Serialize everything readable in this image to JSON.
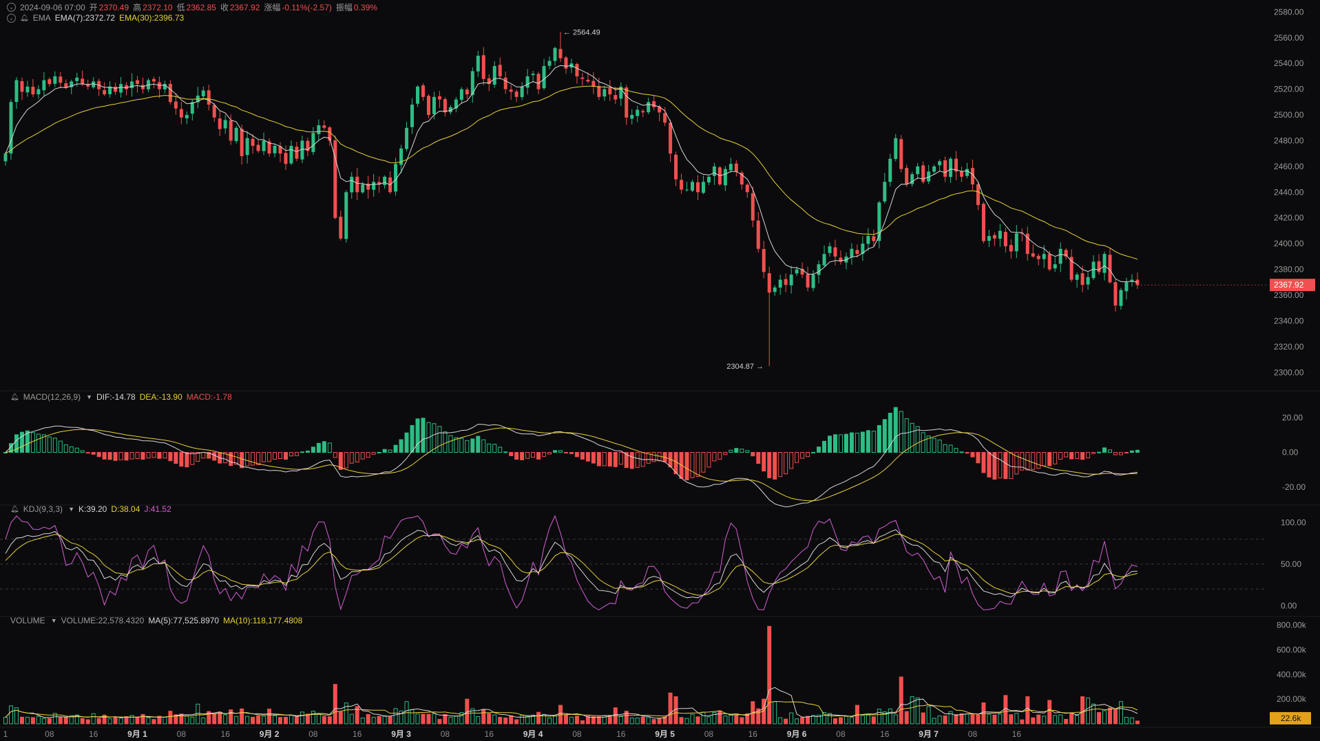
{
  "header": {
    "date": "2024-09-06 07:00",
    "open_label": "开",
    "open": "2370.49",
    "high_label": "高",
    "high": "2372.10",
    "low_label": "低",
    "low": "2362.85",
    "close_label": "收",
    "close": "2367.92",
    "change_label": "涨幅",
    "change": "-0.11%(-2.57)",
    "amplitude_label": "振幅",
    "amplitude": "0.39%"
  },
  "ema": {
    "label": "EMA",
    "ema7": "EMA(7):2372.72",
    "ema30": "EMA(30):2396.73"
  },
  "macd": {
    "label": "MACD(12,26,9)",
    "dif": "DIF:-14.78",
    "dea": "DEA:-13.90",
    "macd": "MACD:-1.78"
  },
  "kdj": {
    "label": "KDJ(9,3,3)",
    "k": "K:39.20",
    "d": "D:38.04",
    "j": "J:41.52"
  },
  "volume": {
    "label": "VOLUME",
    "vol": "VOLUME:22,578.4320",
    "ma5": "MA(5):77,525.8970",
    "ma10": "MA(10):118,177.4808"
  },
  "colors": {
    "up": "#2ebd85",
    "down": "#f0504f",
    "ema7": "#d8d8d8",
    "ema30": "#e9d23b",
    "j": "#d65fd6",
    "bg": "#0b0b0d"
  },
  "chart_data": [
    {
      "type": "candlestick",
      "name": "price",
      "ylim": [
        2290,
        2585
      ],
      "yticks": [
        "2580.00",
        "2560.00",
        "2540.00",
        "2520.00",
        "2500.00",
        "2480.00",
        "2460.00",
        "2440.00",
        "2420.00",
        "2400.00",
        "2380.00",
        "2360.00",
        "2340.00",
        "2320.00",
        "2300.00"
      ],
      "ytick_values": [
        2580,
        2560,
        2540,
        2520,
        2500,
        2480,
        2460,
        2440,
        2420,
        2400,
        2380,
        2360,
        2340,
        2320,
        2300
      ],
      "last_price": "2367.92",
      "last_value": 2367.92,
      "high_marker": "2564.49",
      "high_value": 2564.49,
      "high_index": 101,
      "low_marker": "2304.87",
      "low_value": 2304.87,
      "low_index": 139,
      "close": [
        2470,
        2510,
        2527,
        2518,
        2522,
        2516,
        2520,
        2527,
        2524,
        2530,
        2525,
        2521,
        2526,
        2529,
        2524,
        2522,
        2526,
        2520,
        2516,
        2522,
        2518,
        2524,
        2520,
        2526,
        2524,
        2520,
        2527,
        2526,
        2520,
        2524,
        2510,
        2505,
        2498,
        2500,
        2510,
        2515,
        2519,
        2508,
        2498,
        2489,
        2496,
        2480,
        2490,
        2468,
        2482,
        2476,
        2472,
        2480,
        2470,
        2476,
        2470,
        2462,
        2476,
        2466,
        2480,
        2472,
        2486,
        2492,
        2490,
        2480,
        2420,
        2404,
        2440,
        2452,
        2440,
        2446,
        2442,
        2448,
        2446,
        2452,
        2440,
        2462,
        2474,
        2490,
        2508,
        2522,
        2514,
        2500,
        2514,
        2512,
        2502,
        2506,
        2512,
        2520,
        2516,
        2534,
        2546,
        2528,
        2524,
        2538,
        2530,
        2520,
        2518,
        2514,
        2522,
        2530,
        2532,
        2520,
        2538,
        2542,
        2552,
        2544,
        2536,
        2540,
        2530,
        2528,
        2526,
        2522,
        2514,
        2520,
        2516,
        2512,
        2522,
        2498,
        2500,
        2504,
        2502,
        2510,
        2506,
        2502,
        2494,
        2470,
        2450,
        2442,
        2442,
        2448,
        2440,
        2448,
        2452,
        2460,
        2446,
        2458,
        2462,
        2456,
        2446,
        2440,
        2418,
        2396,
        2378,
        2362,
        2366,
        2372,
        2368,
        2376,
        2380,
        2376,
        2366,
        2376,
        2384,
        2392,
        2398,
        2390,
        2386,
        2390,
        2396,
        2392,
        2400,
        2406,
        2402,
        2432,
        2448,
        2466,
        2482,
        2458,
        2446,
        2454,
        2460,
        2448,
        2456,
        2460,
        2464,
        2452,
        2466,
        2456,
        2452,
        2458,
        2446,
        2430,
        2402,
        2406,
        2404,
        2410,
        2398,
        2394,
        2408,
        2408,
        2392,
        2390,
        2388,
        2392,
        2380,
        2384,
        2396,
        2390,
        2372,
        2376,
        2368,
        2374,
        2386,
        2378,
        2392,
        2370,
        2352,
        2364,
        2370,
        2372,
        2367.92
      ]
    },
    {
      "type": "macd",
      "name": "MACD(12,26,9)",
      "ylim": [
        -28,
        30
      ],
      "yticks": [
        "20.00",
        "0.00",
        "-20.00"
      ],
      "ytick_values": [
        20,
        0,
        -20
      ]
    },
    {
      "type": "kdj",
      "name": "KDJ(9,3,3)",
      "ylim": [
        -8,
        112
      ],
      "yticks": [
        "100.00",
        "50.00",
        "0.00"
      ],
      "ytick_values": [
        100,
        50,
        0
      ],
      "reference_lines": [
        80,
        50,
        20
      ]
    },
    {
      "type": "volume",
      "name": "VOLUME",
      "ylim": [
        0,
        820000
      ],
      "yticks": [
        "800.00k",
        "600.00k",
        "400.00k",
        "200.00k"
      ],
      "ytick_values": [
        800000,
        600000,
        400000,
        200000
      ],
      "last_volume": "22.6k",
      "last_value": 22578.432,
      "spikes": [
        {
          "index": 2,
          "value": 130000
        },
        {
          "index": 35,
          "value": 160000
        },
        {
          "index": 48,
          "value": 120000
        },
        {
          "index": 60,
          "value": 320000
        },
        {
          "index": 64,
          "value": 140000
        },
        {
          "index": 73,
          "value": 180000
        },
        {
          "index": 84,
          "value": 200000
        },
        {
          "index": 101,
          "value": 150000
        },
        {
          "index": 111,
          "value": 130000
        },
        {
          "index": 121,
          "value": 250000
        },
        {
          "index": 122,
          "value": 220000
        },
        {
          "index": 136,
          "value": 180000
        },
        {
          "index": 138,
          "value": 200000
        },
        {
          "index": 139,
          "value": 790000
        },
        {
          "index": 140,
          "value": 180000
        },
        {
          "index": 155,
          "value": 150000
        },
        {
          "index": 163,
          "value": 380000
        },
        {
          "index": 165,
          "value": 220000
        },
        {
          "index": 166,
          "value": 210000
        },
        {
          "index": 168,
          "value": 140000
        },
        {
          "index": 178,
          "value": 170000
        },
        {
          "index": 182,
          "value": 230000
        },
        {
          "index": 186,
          "value": 220000
        },
        {
          "index": 190,
          "value": 190000
        },
        {
          "index": 196,
          "value": 220000
        },
        {
          "index": 197,
          "value": 210000
        },
        {
          "index": 198,
          "value": 160000
        },
        {
          "index": 203,
          "value": 180000
        }
      ]
    }
  ],
  "x_axis": {
    "labels": [
      {
        "text": "1",
        "index": 0
      },
      {
        "text": "08",
        "index": 8
      },
      {
        "text": "16",
        "index": 16
      },
      {
        "text": "9月 1",
        "index": 24
      },
      {
        "text": "08",
        "index": 32
      },
      {
        "text": "16",
        "index": 40
      },
      {
        "text": "9月 2",
        "index": 48
      },
      {
        "text": "08",
        "index": 56
      },
      {
        "text": "16",
        "index": 64
      },
      {
        "text": "9月 3",
        "index": 72
      },
      {
        "text": "08",
        "index": 80
      },
      {
        "text": "16",
        "index": 88
      },
      {
        "text": "9月 4",
        "index": 96
      },
      {
        "text": "08",
        "index": 104
      },
      {
        "text": "16",
        "index": 112
      },
      {
        "text": "9月 5",
        "index": 120
      },
      {
        "text": "08",
        "index": 128
      },
      {
        "text": "16",
        "index": 136
      },
      {
        "text": "9月 6",
        "index": 144
      },
      {
        "text": "08",
        "index": 152
      },
      {
        "text": "16",
        "index": 160
      },
      {
        "text": "9月 7",
        "index": 168
      },
      {
        "text": "08",
        "index": 176
      },
      {
        "text": "16",
        "index": 184
      }
    ]
  }
}
